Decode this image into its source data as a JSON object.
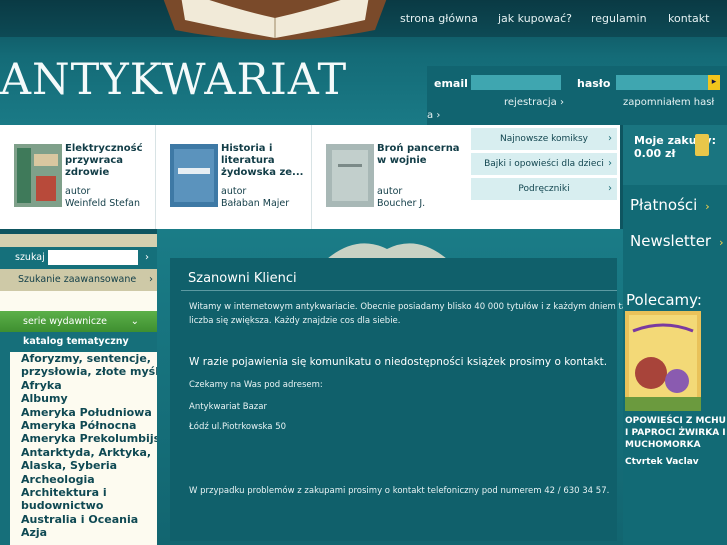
{
  "nav": {
    "items": [
      "strona główna",
      "jak kupować?",
      "regulamin",
      "kontakt"
    ]
  },
  "brand": {
    "logo": "ANTYKWARIAT"
  },
  "login": {
    "email_label": "email",
    "password_label": "hasło",
    "register": "rejestracja",
    "forgot_line1": "zapomniałem hasł",
    "forgot_line2": "a"
  },
  "products": [
    {
      "title": "Elektryczność przywraca zdrowie",
      "author_label": "autor",
      "author": "Weinfeld Stefan"
    },
    {
      "title": "Historia i literatura żydowska ze...",
      "author_label": "autor",
      "author": "Bałaban Majer"
    },
    {
      "title": "Broń pancerna w wojnie",
      "author_label": "autor",
      "author": "Boucher J."
    }
  ],
  "categories": [
    "Najnowsze komiksy",
    "Bajki i opowieści dla dzieci",
    "Podręczniki"
  ],
  "cart": {
    "title": "Moje zakupy:",
    "total": "0.00 zł"
  },
  "right": {
    "payments": "Płatności",
    "newsletter": "Newsletter",
    "recommend": "Polecamy:",
    "rec_title": "OPOWIEŚCI Z MCHU I PAPROCI ŻWIRKA I MUCHOMORKA",
    "rec_title_line1": "OPOWIEŚCI Z MCHU",
    "rec_title_line2": "I PAPROCI ŻWIRKA I",
    "rec_title_line3": "MUCHOMORKA",
    "rec_author": "Ctvrtek Vaclav"
  },
  "search": {
    "label": "szukaj",
    "advanced": "Szukanie zaawansowane"
  },
  "sidebar": {
    "series": "serie wydawnicze",
    "catalog": "katalog tematyczny",
    "items": [
      "Aforyzmy, sentencje,",
      "przysłowia, złote myśli",
      "Afryka",
      "Albumy",
      "Ameryka Południowa",
      "Ameryka Północna",
      "Ameryka Prekolumbijska",
      "Antarktyda, Arktyka,",
      "Alaska, Syberia",
      "Archeologia",
      "Architektura i",
      "budownictwo",
      "Australia i Oceania",
      "Azja"
    ]
  },
  "main": {
    "title": "Szanowni Klienci",
    "p1_line1": "Witamy w internetowym antykwariacie. Obecnie posiadamy blisko 40 000 tytułów  i z każdym dniem ta",
    "p1_line2": "liczba się zwiększa. Każdy  znajdzie cos dla siebie.",
    "notice": "W razie pojawienia się komunikatu o niedostępności książek prosimy o kontakt.",
    "wait": "Czekamy na Was pod adresem:",
    "addr1": "Antykwariat Bazar",
    "addr2": "Łódź ul.Piotrkowska 50",
    "phone": "W przypadku problemów z zakupami prosimy o kontakt telefoniczny pod numerem 42 / 630 34 57."
  }
}
